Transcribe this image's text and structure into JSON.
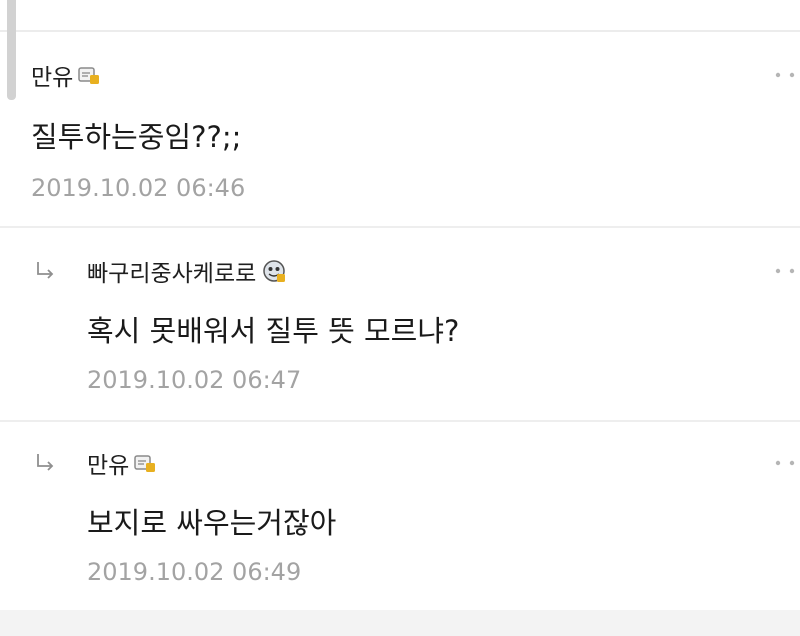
{
  "comments": [
    {
      "author": "만유",
      "badge_icon": "note-badge-icon",
      "text": "질투하는중임??;;",
      "date": "2019.10.02 06:46",
      "is_reply": false
    },
    {
      "author": "빠구리중사케로로",
      "badge_icon": "avatar-badge-icon",
      "text": "혹시 못배워서 질투 뜻 모르냐?",
      "date": "2019.10.02 06:47",
      "is_reply": true
    },
    {
      "author": "만유",
      "badge_icon": "note-badge-icon",
      "text": "보지로 싸우는거잖아",
      "date": "2019.10.02 06:49",
      "is_reply": true
    }
  ],
  "colors": {
    "text": "#1a1a1a",
    "date": "#a3a3a3",
    "badge": "#e8b020",
    "divider": "#eeeeee"
  }
}
